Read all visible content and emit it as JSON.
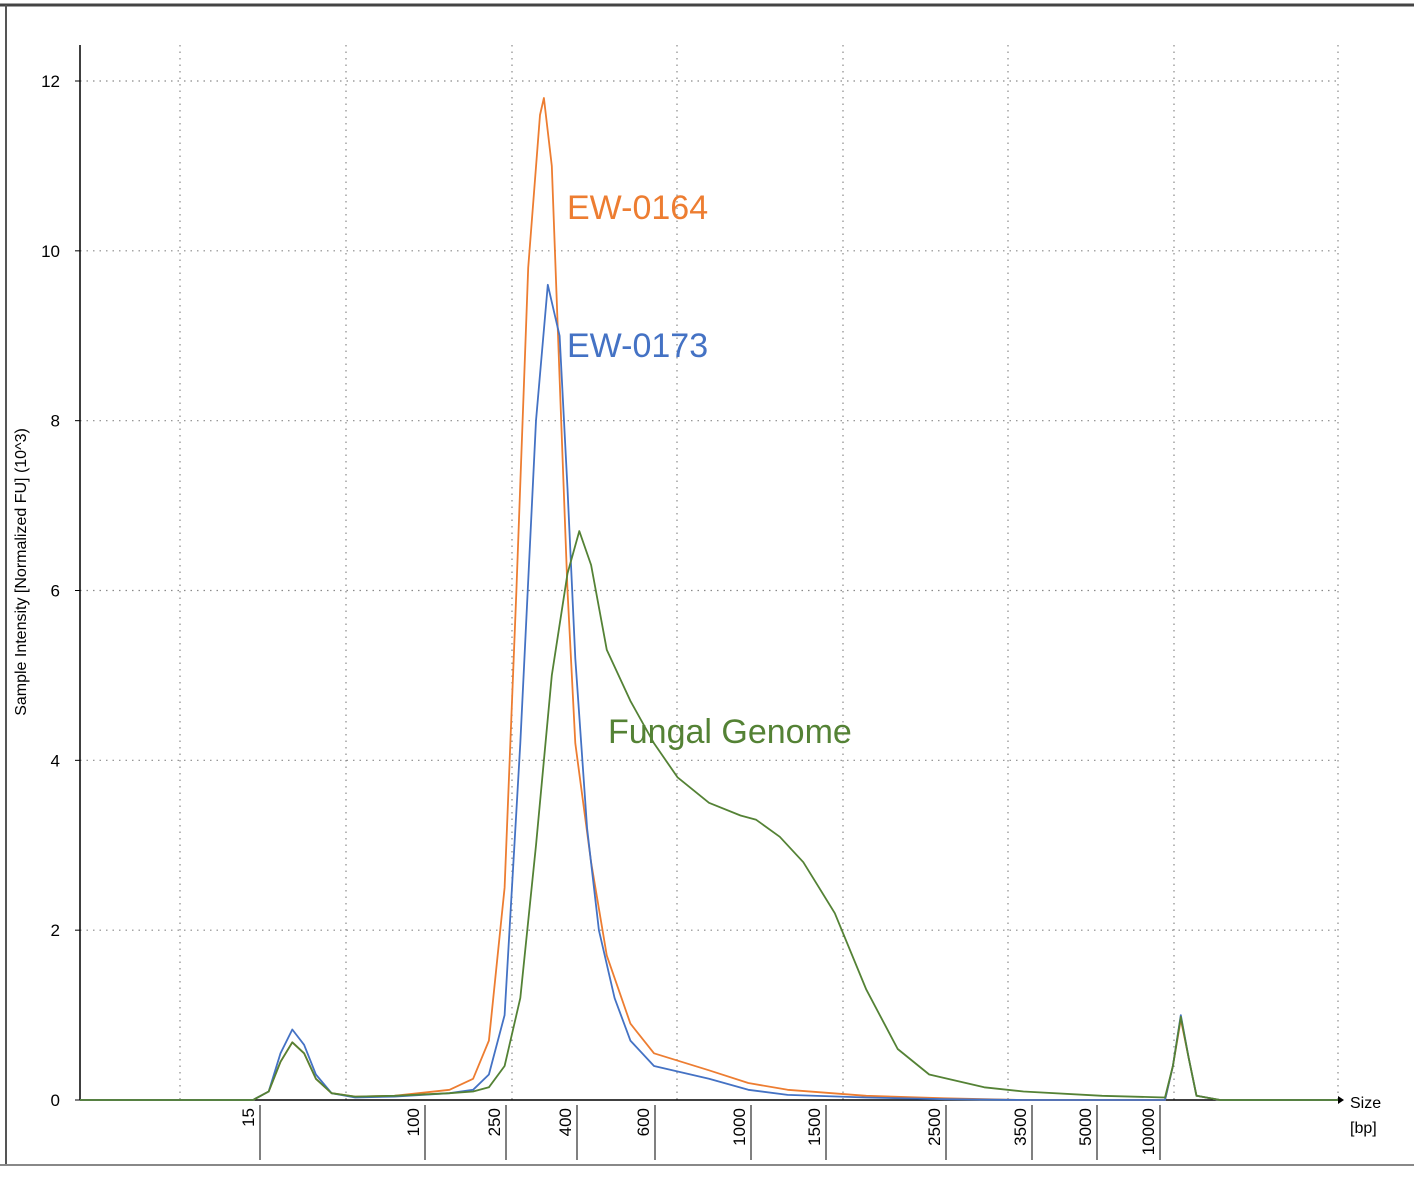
{
  "chart_data": {
    "type": "line",
    "ylabel": "Sample Intensity [Normalized FU] (10^3)",
    "xlabel": "Size",
    "xunit": "[bp]",
    "ylim": [
      0,
      12
    ],
    "yticks": [
      0,
      2,
      4,
      6,
      8,
      10,
      12
    ],
    "xtick_labels": [
      "15",
      "100",
      "250",
      "400",
      "600",
      "1000",
      "1500",
      "2500",
      "3500",
      "5000",
      "10000"
    ],
    "grid": true,
    "annotations": [
      {
        "text": "EW-0164",
        "color": "#ED7D31"
      },
      {
        "text": "EW-0173",
        "color": "#4472C4"
      },
      {
        "text": "Fungal Genome",
        "color": "#548235"
      }
    ],
    "series": [
      {
        "name": "EW-0164",
        "color": "#ED7D31",
        "points": [
          [
            0,
            0
          ],
          [
            22,
            0
          ],
          [
            24,
            0.1
          ],
          [
            25.5,
            0.45
          ],
          [
            27,
            0.68
          ],
          [
            28.5,
            0.55
          ],
          [
            30,
            0.25
          ],
          [
            32,
            0.08
          ],
          [
            35,
            0.04
          ],
          [
            40,
            0.05
          ],
          [
            47,
            0.12
          ],
          [
            50,
            0.25
          ],
          [
            52,
            0.7
          ],
          [
            54,
            2.5
          ],
          [
            55.5,
            6.0
          ],
          [
            57,
            9.8
          ],
          [
            58.5,
            11.6
          ],
          [
            59,
            11.8
          ],
          [
            60,
            11.0
          ],
          [
            61,
            8.5
          ],
          [
            62,
            6.0
          ],
          [
            63,
            4.2
          ],
          [
            65,
            2.8
          ],
          [
            67,
            1.7
          ],
          [
            70,
            0.9
          ],
          [
            73,
            0.55
          ],
          [
            80,
            0.35
          ],
          [
            85,
            0.2
          ],
          [
            90,
            0.12
          ],
          [
            100,
            0.05
          ],
          [
            110,
            0.02
          ],
          [
            120,
            0
          ],
          [
            138,
            0
          ],
          [
            139,
            0.4
          ],
          [
            140,
            0.95
          ],
          [
            141,
            0.5
          ],
          [
            142,
            0.05
          ],
          [
            145,
            0
          ],
          [
            160,
            0
          ]
        ]
      },
      {
        "name": "EW-0173",
        "color": "#4472C4",
        "points": [
          [
            0,
            0
          ],
          [
            22,
            0
          ],
          [
            24,
            0.1
          ],
          [
            25.5,
            0.55
          ],
          [
            27,
            0.83
          ],
          [
            28.5,
            0.65
          ],
          [
            30,
            0.3
          ],
          [
            32,
            0.08
          ],
          [
            35,
            0.03
          ],
          [
            40,
            0.04
          ],
          [
            47,
            0.08
          ],
          [
            50,
            0.12
          ],
          [
            52,
            0.3
          ],
          [
            54,
            1.0
          ],
          [
            56,
            4.2
          ],
          [
            58,
            8.0
          ],
          [
            59.5,
            9.6
          ],
          [
            61,
            9.0
          ],
          [
            62,
            7.2
          ],
          [
            63,
            5.2
          ],
          [
            64.5,
            3.2
          ],
          [
            66,
            2.0
          ],
          [
            68,
            1.2
          ],
          [
            70,
            0.7
          ],
          [
            73,
            0.4
          ],
          [
            80,
            0.25
          ],
          [
            85,
            0.12
          ],
          [
            90,
            0.06
          ],
          [
            100,
            0.03
          ],
          [
            110,
            0.01
          ],
          [
            120,
            0
          ],
          [
            138,
            0
          ],
          [
            139,
            0.4
          ],
          [
            140,
            1.0
          ],
          [
            141,
            0.5
          ],
          [
            142,
            0.05
          ],
          [
            145,
            0
          ],
          [
            160,
            0
          ]
        ]
      },
      {
        "name": "Fungal Genome",
        "color": "#548235",
        "points": [
          [
            0,
            0
          ],
          [
            22,
            0
          ],
          [
            24,
            0.1
          ],
          [
            25.5,
            0.45
          ],
          [
            27,
            0.68
          ],
          [
            28.5,
            0.55
          ],
          [
            30,
            0.25
          ],
          [
            32,
            0.08
          ],
          [
            35,
            0.04
          ],
          [
            40,
            0.05
          ],
          [
            47,
            0.08
          ],
          [
            50,
            0.1
          ],
          [
            52,
            0.15
          ],
          [
            54,
            0.4
          ],
          [
            56,
            1.2
          ],
          [
            58,
            3.0
          ],
          [
            60,
            5.0
          ],
          [
            62,
            6.2
          ],
          [
            63.5,
            6.7
          ],
          [
            65,
            6.3
          ],
          [
            67,
            5.3
          ],
          [
            70,
            4.7
          ],
          [
            73,
            4.2
          ],
          [
            76,
            3.8
          ],
          [
            80,
            3.5
          ],
          [
            84,
            3.35
          ],
          [
            86,
            3.3
          ],
          [
            89,
            3.1
          ],
          [
            92,
            2.8
          ],
          [
            94,
            2.5
          ],
          [
            96,
            2.2
          ],
          [
            100,
            1.3
          ],
          [
            104,
            0.6
          ],
          [
            108,
            0.3
          ],
          [
            115,
            0.15
          ],
          [
            120,
            0.1
          ],
          [
            130,
            0.05
          ],
          [
            138,
            0.03
          ],
          [
            139,
            0.4
          ],
          [
            140,
            0.98
          ],
          [
            141,
            0.5
          ],
          [
            142,
            0.05
          ],
          [
            145,
            0
          ],
          [
            160,
            0
          ]
        ]
      }
    ]
  }
}
